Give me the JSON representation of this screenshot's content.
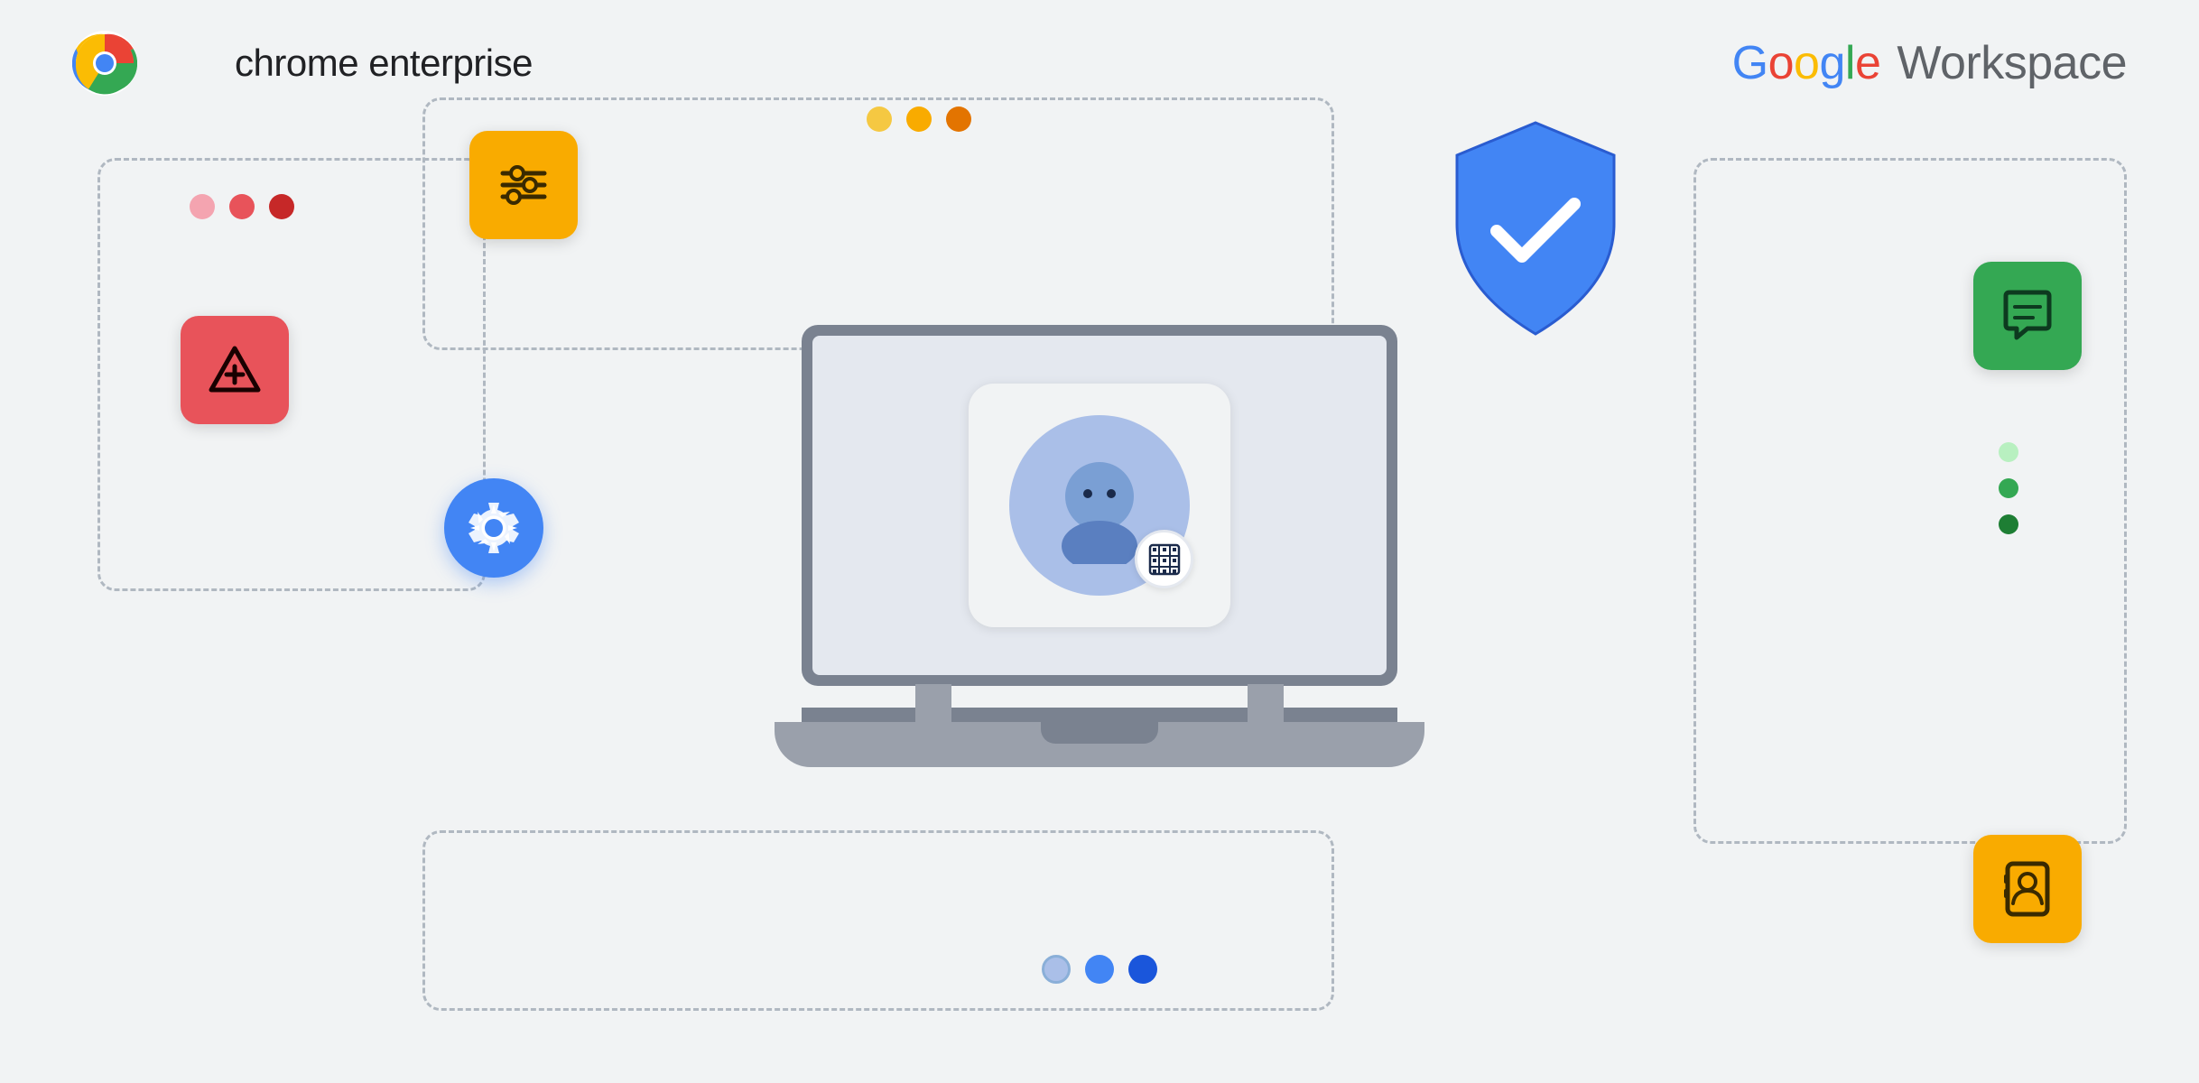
{
  "header": {
    "chrome_enterprise_label": "chrome enterprise",
    "google_workspace_label": "Google Workspace"
  },
  "dots": {
    "top": [
      {
        "color": "#f8c84c",
        "size": 28
      },
      {
        "color": "#f9ab00",
        "size": 28
      },
      {
        "color": "#e37400",
        "size": 28
      }
    ],
    "left": [
      {
        "color": "#f4a4b0",
        "size": 28
      },
      {
        "color": "#e8535a",
        "size": 28
      },
      {
        "color": "#c62828",
        "size": 28
      }
    ],
    "bottom": [
      {
        "color": "#aabfe8",
        "size": 32
      },
      {
        "color": "#4285f4",
        "size": 32
      },
      {
        "color": "#1a56db",
        "size": 32
      }
    ],
    "right_vertical": [
      {
        "color": "#b8f0c0",
        "size": 22
      },
      {
        "color": "#34a853",
        "size": 22
      },
      {
        "color": "#1e7e34",
        "size": 22
      }
    ]
  },
  "icons": {
    "shield": "shield-checkmark",
    "gear": "gear-settings",
    "settings_sliders": "settings-sliders",
    "alert_add": "alert-add",
    "chat": "chat-message",
    "contacts": "contacts-person"
  }
}
